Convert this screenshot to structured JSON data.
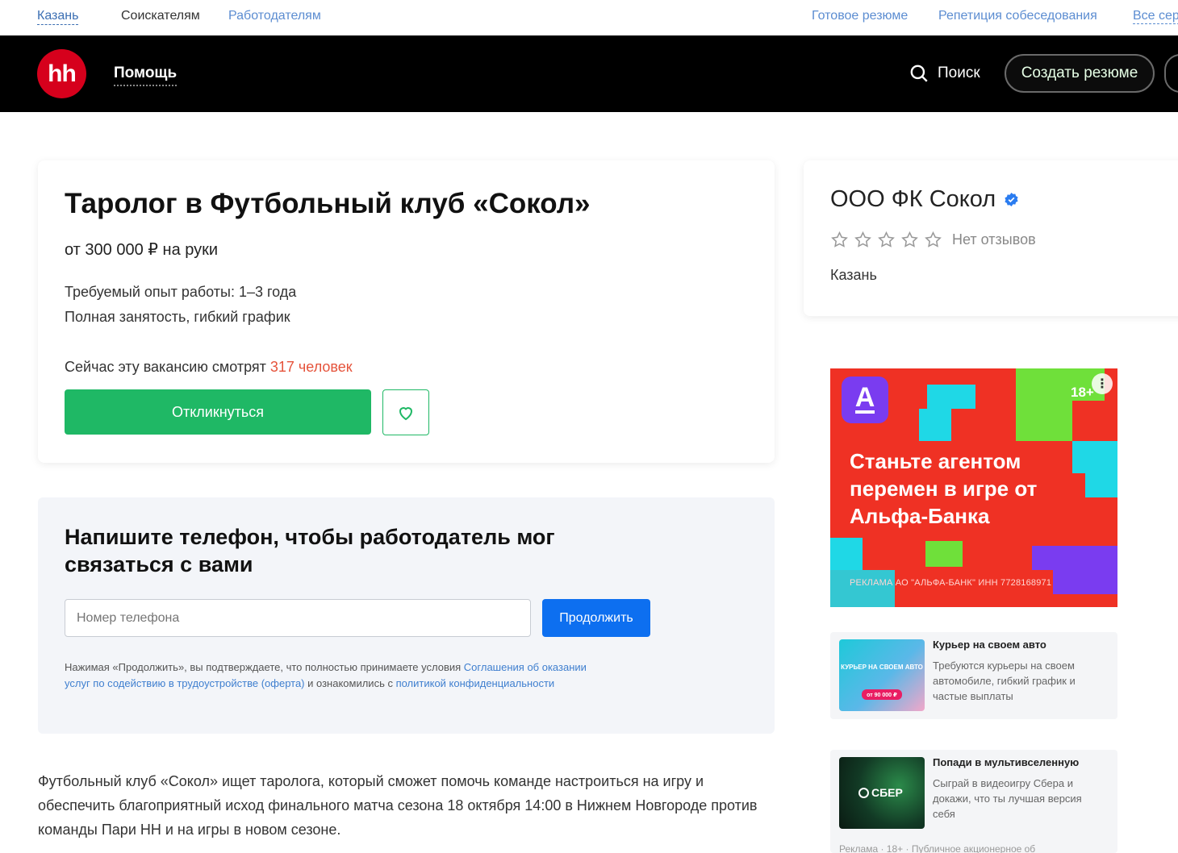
{
  "topbar": {
    "city": "Казань",
    "seekers": "Соискателям",
    "employers": "Работодателям",
    "ready_resume": "Готовое резюме",
    "interview": "Репетиция собеседования",
    "all_services": "Все сер"
  },
  "header": {
    "logo": "hh",
    "help": "Помощь",
    "search": "Поиск",
    "create_resume": "Создать резюме"
  },
  "vacancy": {
    "title": "Таролог в Футбольный клуб «Сокол»",
    "salary": "от 300 000 ₽ на руки",
    "experience": "Требуемый опыт работы: 1–3 года",
    "employment": "Полная занятость, гибкий график",
    "watching_prefix": "Сейчас эту вакансию смотрят ",
    "watching_count": "317 человек",
    "apply": "Откликнуться"
  },
  "phone": {
    "title": "Напишите телефон, чтобы работодатель мог связаться с вами",
    "placeholder": "Номер телефона",
    "continue": "Продолжить",
    "terms_1": "Нажимая «Продолжить», вы подтверждаете, что полностью принимаете условия ",
    "terms_link_1": "Соглашения об оказании услуг по содействию в трудоустройстве (оферта)",
    "terms_2": " и ознакомились с ",
    "terms_link_2": "политикой конфиденциальности"
  },
  "description": "Футбольный клуб «Сокол» ищет таролога, который сможет помочь команде настроиться на игру и обеспечить благоприятный исход финального матча сезона 18 октября 14:00 в Нижнем Новгороде против команды Пари НН и на игры в новом сезоне.",
  "company": {
    "name": "ООО ФК Сокол",
    "rating_stars": 0,
    "no_reviews": "Нет отзывов",
    "city": "Казань"
  },
  "banner": {
    "logo_letter": "А",
    "age": "18+",
    "text": "Станьте агентом перемен в игре от Альфа-Банка",
    "legal": "РЕКЛАМА АО \"АЛЬФА-БАНК\" ИНН 7728168971"
  },
  "ads": [
    {
      "title": "Курьер на своем авто",
      "text": "Требуются курьеры на своем автомобиле, гибкий график и частые выплаты",
      "thumb_text": "КУРЬЕР НА СВОЕМ АВТО",
      "thumb_price": "от 90 000 ₽"
    },
    {
      "title": "Попади в мультивселенную",
      "text": "Сыграй в видеоигру Сбера и докажи, что ты лучшая версия себя",
      "thumb_text": "СБЕР",
      "footer": "Реклама · 18+ · Публичное акционерное об"
    }
  ],
  "colors": {
    "brand_red": "#d6001c",
    "apply_green": "#1fb865",
    "continue_blue": "#0d6ff0",
    "alfa_red": "#ef3124"
  }
}
